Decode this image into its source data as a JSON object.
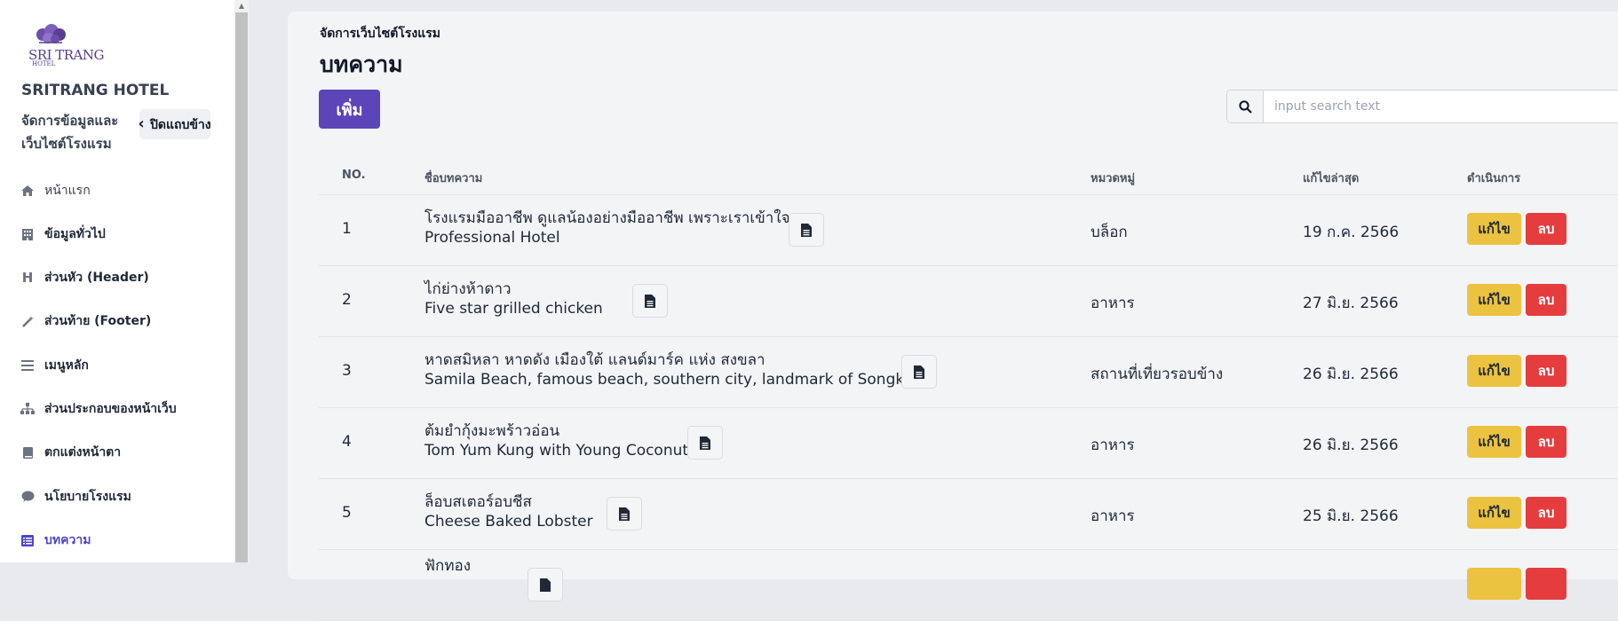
{
  "sidebar": {
    "logo": {
      "word": "SRI TRANG",
      "sub": "HOTEL"
    },
    "hotel_name": "SRITRANG HOTEL",
    "hotel_desc": "จัดการข้อมูลและเว็บไซต์โรงแรม",
    "collapse_label": "ปิดแถบข้าง",
    "items": [
      {
        "label": "หน้าแรก",
        "icon": "home-icon"
      },
      {
        "label": "ข้อมูลทั่วไป",
        "icon": "building-icon"
      },
      {
        "label": "ส่วนหัว (Header)",
        "icon": "heading-icon"
      },
      {
        "label": "ส่วนท้าย (Footer)",
        "icon": "magic-wand-icon"
      },
      {
        "label": "เมนูหลัก",
        "icon": "list-icon"
      },
      {
        "label": "ส่วนประกอบของหน้าเว็บ",
        "icon": "sitemap-icon"
      },
      {
        "label": "ตกแต่งหน้าตา",
        "icon": "book-icon"
      },
      {
        "label": "นโยบายโรงแรม",
        "icon": "comment-icon"
      },
      {
        "label": "บทความ",
        "icon": "table-list-icon",
        "active": true
      }
    ]
  },
  "main": {
    "breadcrumb": "จัดการเว็บไซต์โรงแรม",
    "title": "บทความ",
    "add_label": "เพิ่ม",
    "search_placeholder": "input search text",
    "columns": [
      "NO.",
      "ชื่อบทความ",
      "หมวดหมู่",
      "แก้ไขล่าสุด",
      "ดำเนินการ"
    ],
    "rows": [
      {
        "no": "1",
        "title_th": "โรงแรมมืออาชีพ ดูแลน้องอย่างมืออาชีพ เพราะเราเข้าใจ",
        "title_en": "Professional Hotel",
        "category": "บล็อก",
        "date": "19 ก.ค. 2566"
      },
      {
        "no": "2",
        "title_th": "ไก่ย่างห้าดาว",
        "title_en": "Five star grilled chicken",
        "category": "อาหาร",
        "date": "27 มิ.ย. 2566"
      },
      {
        "no": "3",
        "title_th": "หาดสมิหลา หาดดัง เมืองใต้ แลนด์มาร์ค แห่ง สงขลา",
        "title_en": "Samila Beach, famous beach, southern city, landmark of Songkhla",
        "category": "สถานที่เที่ยวรอบข้าง",
        "date": "26 มิ.ย. 2566"
      },
      {
        "no": "4",
        "title_th": "ต้มยำกุ้งมะพร้าวอ่อน",
        "title_en": "Tom Yum Kung with Young Coconut",
        "category": "อาหาร",
        "date": "26 มิ.ย. 2566"
      },
      {
        "no": "5",
        "title_th": "ล็อบสเตอร์อบชีส",
        "title_en": "Cheese Baked Lobster",
        "category": "อาหาร",
        "date": "25 มิ.ย. 2566"
      },
      {
        "no": "",
        "title_th": "ฟักทอง",
        "title_en": "",
        "category": "",
        "date": ""
      }
    ],
    "edit_label": "แก้ไข",
    "delete_label": "ลบ"
  },
  "colors": {
    "primary": "#5b45b8",
    "edit": "#ecc340",
    "delete": "#e53d3d",
    "active_nav": "#4f46c9"
  }
}
